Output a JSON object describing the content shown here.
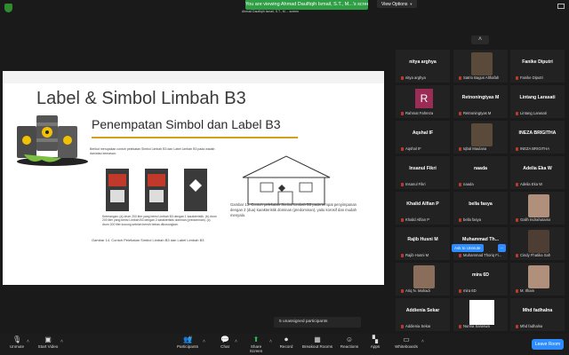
{
  "topbar": {
    "viewing_banner": "You are viewing Ahmad Daulfiqih Ismail, S.T., M...'s screen",
    "viewing_sub": "Ahmad Daulfiqih Ismail, S.T., M.... screen",
    "view_options": "View Options"
  },
  "slide": {
    "title": "Label & Simbol Limbah B3",
    "subtitle": "Penempatan Simbol dan Label B3",
    "caption_left": "Gambar 14. Contoh Pelekatan Simbol Limbah B3 dan Label Limbah B3",
    "caption_right": "Gambar 13. Contoh pelekatan Simbol Limbah B3 pada tempat penyimpanan dengan 2 (dua) karakteristik dominan (predominan), yaitu korosif dan mudah menyala.",
    "doc_text": "Berikut merupakan contoh pelekatan Simbol Limbah B3 dan Label Limbah B3 pada wadah dan/atau kemasan:",
    "doc_notes": "Keterangan: (a) drum 200 liter yang berisi Limbah B3 dengan 1 karakteristik. (b) drum 200 liter yang berisi Limbah B3 dengan 2 karakteristik dominan (predominan). (c) drum 200 liter kosong setelah bersih bebas dikosongkan.",
    "doc_labels": [
      "(a)",
      "(b)",
      "(c)"
    ]
  },
  "participants": [
    {
      "name": "nitya arghya",
      "label": "nitya arghya",
      "type": "name"
    },
    {
      "name": "",
      "label": "Satrio Bagus Althafah",
      "type": "photo"
    },
    {
      "name": "Fanike Diputri",
      "label": "Fanike Diputri",
      "type": "name"
    },
    {
      "name": "R",
      "label": "Rahmat Fahreza",
      "type": "avatar"
    },
    {
      "name": "Retnoningtyas M",
      "label": "Retnoningtyas M",
      "type": "name"
    },
    {
      "name": "Lintang Larasati",
      "label": "Lintang Larasati",
      "type": "name"
    },
    {
      "name": "Aqshal IF",
      "label": "Aqshal IF",
      "type": "name"
    },
    {
      "name": "",
      "label": "Iqbal Maulana",
      "type": "photo"
    },
    {
      "name": "INEZA BRIGITHA",
      "label": "INEZA BRIGITHA",
      "type": "name"
    },
    {
      "name": "Insanul Fikri",
      "label": "Insanul Fikri",
      "type": "name"
    },
    {
      "name": "naada",
      "label": "naada",
      "type": "name"
    },
    {
      "name": "Adelia Eka W",
      "label": "Adelia Eka W",
      "type": "name"
    },
    {
      "name": "Khalid Alfian P",
      "label": "Khalid Alfian P",
      "type": "name"
    },
    {
      "name": "bella fasya",
      "label": "bella fasya",
      "type": "name"
    },
    {
      "name": "",
      "label": "Galih Indrahutama",
      "type": "photo"
    },
    {
      "name": "Rajib Husni M",
      "label": "Rajib Husni M",
      "type": "name"
    },
    {
      "name": "Muhammad  Th...",
      "label": "Muhammad Thoriq Fi...",
      "type": "name"
    },
    {
      "name": "",
      "label": "Cindy Fhatika Sah",
      "type": "photo"
    },
    {
      "name": "",
      "label": "Ariq N. Mahadi",
      "type": "photo"
    },
    {
      "name": "mira 6D",
      "label": "mira 6D",
      "type": "name"
    },
    {
      "name": "",
      "label": "M. Ilham",
      "type": "photo"
    },
    {
      "name": "Addienia Sekar",
      "label": "Addienia Sekar",
      "type": "name"
    },
    {
      "name": "",
      "label": "Nurina Saraswa",
      "type": "white"
    },
    {
      "name": "Mhd fadhalna",
      "label": "Mhd fadhalna",
      "type": "name"
    }
  ],
  "ask_to_unmute": "Ask to Unmute",
  "more_dots": "...",
  "unassigned": "5 unassigned participants",
  "toolbar": {
    "unmute": "Unmute",
    "start_video": "Start Video",
    "participants": "Participants",
    "participant_count": "44",
    "chat": "Chat",
    "share_screen": "Share Screen",
    "record": "Record",
    "breakout": "Breakout Rooms",
    "reactions": "Reactions",
    "apps": "Apps",
    "whiteboards": "Whiteboards",
    "leave": "Leave Room"
  }
}
